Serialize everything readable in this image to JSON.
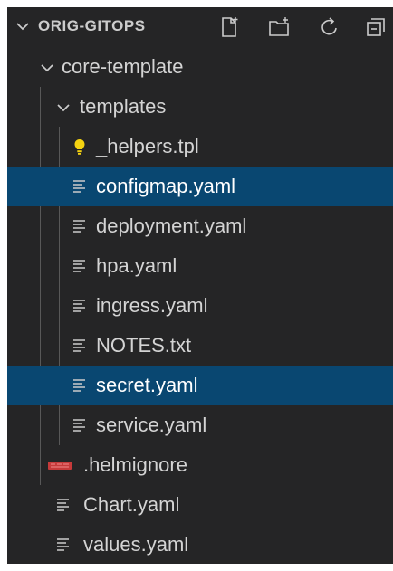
{
  "explorer": {
    "title": "ORIG-GITOPS",
    "actions": [
      {
        "icon": "new-file-icon"
      },
      {
        "icon": "new-folder-icon"
      },
      {
        "icon": "refresh-icon"
      },
      {
        "icon": "collapse-all-icon"
      }
    ]
  },
  "tree": {
    "root_folder": "core-template",
    "sub_folder": "templates",
    "templates_files": [
      {
        "label": "_helpers.tpl",
        "icon": "lightbulb-icon",
        "selected": false
      },
      {
        "label": "configmap.yaml",
        "icon": "file-lines-icon",
        "selected": true
      },
      {
        "label": "deployment.yaml",
        "icon": "file-lines-icon",
        "selected": false
      },
      {
        "label": "hpa.yaml",
        "icon": "file-lines-icon",
        "selected": false
      },
      {
        "label": "ingress.yaml",
        "icon": "file-lines-icon",
        "selected": false
      },
      {
        "label": "NOTES.txt",
        "icon": "file-lines-icon",
        "selected": false
      },
      {
        "label": "secret.yaml",
        "icon": "file-lines-icon",
        "selected": true
      },
      {
        "label": "service.yaml",
        "icon": "file-lines-icon",
        "selected": false
      }
    ],
    "root_files": [
      {
        "label": ".helmignore",
        "icon": "ignore-file-icon"
      },
      {
        "label": "Chart.yaml",
        "icon": "file-lines-icon"
      },
      {
        "label": "values.yaml",
        "icon": "file-lines-icon"
      }
    ]
  },
  "colors": {
    "panel_bg": "#252526",
    "selection_bg": "#094771",
    "text": "#d4d4d4",
    "lightbulb": "#f5d311",
    "ignore_icon": "#c63a3a"
  }
}
